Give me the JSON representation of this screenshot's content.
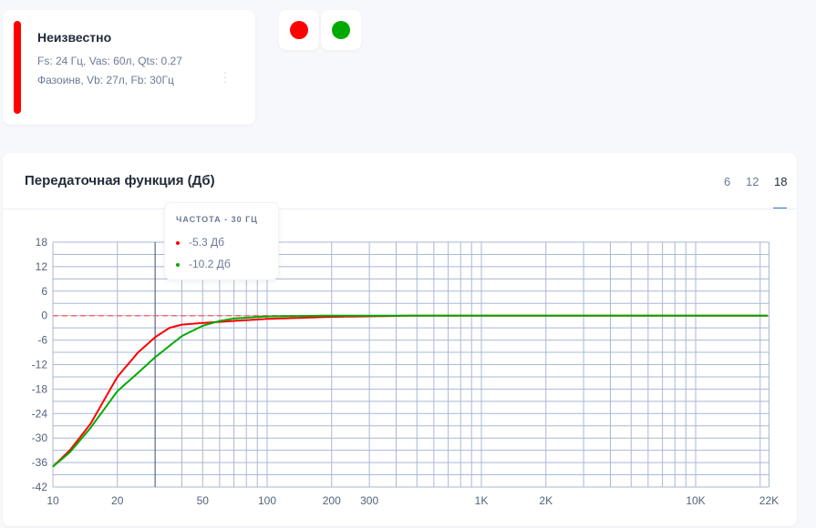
{
  "speaker": {
    "title": "Неизвестно",
    "desc_line1": "Fs: 24 Гц, Vas: 60л, Qts: 0.27",
    "desc_line2": "Фазоинв, Vb: 27л, Fb: 30Гц",
    "color": "#ff0000"
  },
  "swatches": [
    {
      "color": "#ff0000"
    },
    {
      "color": "#00aa00"
    }
  ],
  "panel": {
    "title": "Передаточная функция (Дб)",
    "orders": [
      "6",
      "12",
      "18"
    ],
    "active_order": "18"
  },
  "tooltip": {
    "header": "ЧАСТОТА - 30 ГЦ",
    "rows": [
      {
        "value": "-5.3 Дб",
        "color": "#ff0000"
      },
      {
        "value": "-10.2 Дб",
        "color": "#00aa00"
      }
    ]
  },
  "chart_data": {
    "type": "line",
    "title": "Передаточная функция (Дб)",
    "xlabel": "",
    "ylabel": "",
    "xscale": "log",
    "xlim": [
      10,
      22000
    ],
    "ylim": [
      -42,
      18
    ],
    "yticks": [
      18,
      12,
      6,
      0,
      -6,
      -12,
      -18,
      -24,
      -30,
      -36,
      -42
    ],
    "xticks": [
      {
        "v": 10,
        "l": "10"
      },
      {
        "v": 20,
        "l": "20"
      },
      {
        "v": 50,
        "l": "50"
      },
      {
        "v": 100,
        "l": "100"
      },
      {
        "v": 200,
        "l": "200"
      },
      {
        "v": 300,
        "l": "300"
      },
      {
        "v": 1000,
        "l": "1K"
      },
      {
        "v": 2000,
        "l": "2K"
      },
      {
        "v": 10000,
        "l": "10K"
      },
      {
        "v": 22000,
        "l": "22K"
      }
    ],
    "grid": true,
    "cursor_x": 30,
    "reference_y": 0,
    "series": [
      {
        "color": "#ff0000",
        "x": [
          10,
          12,
          15,
          20,
          25,
          30,
          35,
          40,
          50,
          70,
          100,
          200,
          500,
          22000
        ],
        "y": [
          -37,
          -33,
          -26.5,
          -15,
          -9,
          -5.3,
          -3,
          -2.2,
          -1.8,
          -1.3,
          -0.8,
          -0.3,
          0,
          0
        ]
      },
      {
        "color": "#00aa00",
        "x": [
          10,
          12,
          15,
          20,
          25,
          30,
          40,
          50,
          60,
          70,
          100,
          200,
          500,
          22000
        ],
        "y": [
          -37,
          -33.5,
          -27.5,
          -18.5,
          -14,
          -10.2,
          -5,
          -2.5,
          -1.3,
          -0.7,
          -0.2,
          0,
          0,
          0
        ]
      }
    ]
  }
}
